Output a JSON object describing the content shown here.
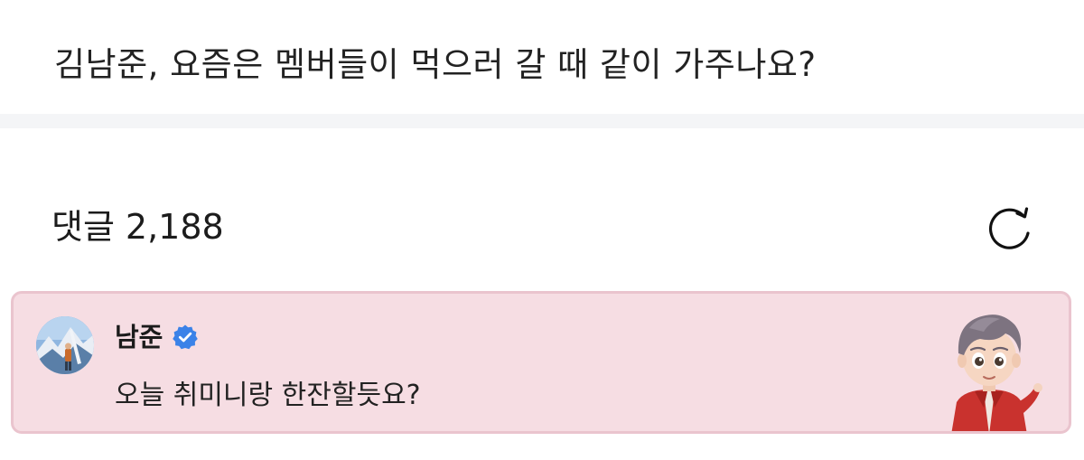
{
  "post": {
    "title": "김남준, 요즘은 멤버들이 먹으러 갈 때 같이 가주나요?"
  },
  "comments": {
    "label": "댓글",
    "count": "2,188",
    "refresh_icon": "refresh-icon"
  },
  "featured_comment": {
    "author": "남준",
    "verified_icon": "verified-badge-icon",
    "text": "오늘 취미니랑 한잔할듯요?",
    "background_color": "#f6dde3",
    "border_color": "#eac4ce",
    "verified_color": "#3b82e8"
  }
}
